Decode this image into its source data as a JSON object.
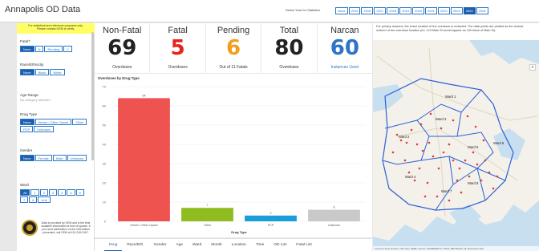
{
  "app": {
    "title": "Annapolis OD Data"
  },
  "years": {
    "label": "Select Year for Statistics",
    "options": [
      "None",
      "2015",
      "2016",
      "2017",
      "2018",
      "2019",
      "2020",
      "2021",
      "2022",
      "2023",
      "2024",
      "2025"
    ],
    "selected": "2024"
  },
  "sidebar": {
    "disclaimer_line1": "For statistical and reference purposes only.",
    "disclaimer_line2": "Please contact OEM to verify.",
    "fatal": {
      "label": "Fatal?",
      "options": [
        "None",
        "N",
        "Pending",
        "Y"
      ]
    },
    "race": {
      "label": "Race/Ethnicity",
      "options": [
        "None",
        "Black",
        "White"
      ]
    },
    "age": {
      "label": "Age Range",
      "sub": "No category selected"
    },
    "drug": {
      "label": "Drug Type",
      "options": [
        "None",
        "Heroin / Other Opioid",
        "Other",
        "PCP",
        "Unknown"
      ]
    },
    "gender": {
      "label": "Gender",
      "options": [
        "None",
        "Female",
        "Male",
        "Unknown"
      ]
    },
    "ward": {
      "label": "Ward",
      "options": [
        "All",
        "1",
        "2",
        "3",
        "4",
        "5",
        "6",
        "7",
        "8",
        "Unk"
      ]
    },
    "footer_text": "Data is provided by OEM and is the best available information at time of update. If you need clarification on the information presented, call OEM at 410-216-9167."
  },
  "kpis": [
    {
      "title": "Non-Fatal",
      "value": "69",
      "sub": "Overdoses",
      "color": "#222222"
    },
    {
      "title": "Fatal",
      "value": "5",
      "sub": "Overdoses",
      "color": "#e5231b"
    },
    {
      "title": "Pending",
      "value": "6",
      "sub": "Out of 11 Fatals",
      "color": "#f0a020"
    },
    {
      "title": "Total",
      "value": "80",
      "sub": "Overdoses",
      "color": "#222222"
    },
    {
      "title": "Narcan",
      "value": "60",
      "sub": "Instances Used",
      "color": "#2e75c7"
    }
  ],
  "chart_data": {
    "type": "bar",
    "title": "Overdoses by Drug Type",
    "xlabel": "Drug Type",
    "ylabel": "",
    "categories": [
      "Heroin / Other Opioid",
      "Other",
      "PCP",
      "Unknown"
    ],
    "values": [
      64,
      7,
      3,
      6
    ],
    "colors": [
      "#ef5350",
      "#8fbc1f",
      "#1a9ed9",
      "#c9c9c9"
    ],
    "ylim": [
      0,
      70
    ],
    "yticks": [
      0,
      10,
      20,
      30,
      40,
      50,
      60,
      70
    ],
    "grid": true
  },
  "tabs": {
    "items": [
      "Drug",
      "Race/Eth.",
      "Gender",
      "Age",
      "Ward",
      "Month",
      "Location",
      "Time",
      "OD List",
      "Fatal List"
    ],
    "active": "Drug"
  },
  "map": {
    "note": "For privacy reasons, the exact location of the overdose is redacted. The data points are plotted as the closest uniform of the overdose location (ex: 123 Main St would appear as 100 block of Main St).",
    "wards": [
      "Ward 1",
      "Ward 2",
      "Ward 3",
      "Ward 4",
      "Ward 5",
      "Ward 6",
      "Ward 7",
      "Ward 8"
    ],
    "attribution": "County of Anne Arundel, VITA, Esri, HERE, Garmin, INCREMENT P, USGS, METI/NASA, NL   Powered by Esri",
    "colors": {
      "water": "#c8dff0",
      "land": "#f4f1ea",
      "ward_outline": "#2b5fd6",
      "incident": "#e53935"
    }
  }
}
